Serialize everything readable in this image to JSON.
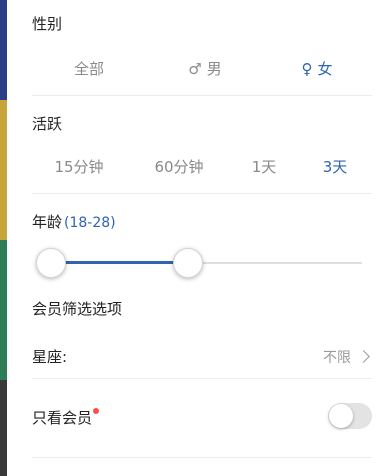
{
  "gender": {
    "label": "性别",
    "options": [
      {
        "label": "全部",
        "symbol": "",
        "active": false
      },
      {
        "label": "男",
        "symbol": "♂",
        "active": false
      },
      {
        "label": "女",
        "symbol": "♀",
        "active": true
      }
    ]
  },
  "active": {
    "label": "活跃",
    "options": [
      {
        "label": "15分钟",
        "active": false
      },
      {
        "label": "60分钟",
        "active": false
      },
      {
        "label": "1天",
        "active": false
      },
      {
        "label": "3天",
        "active": true
      }
    ]
  },
  "age": {
    "label": "年龄",
    "range": "(18-28)",
    "min_value": 18,
    "max_value": 28
  },
  "member_filter": {
    "title": "会员筛选选项",
    "zodiac_label": "星座:",
    "zodiac_value": "不限",
    "member_only_label": "只看会员",
    "member_only_on": false
  },
  "colors": {
    "accent": "#2f63b3",
    "inactive_text": "#8a8a8a",
    "badge": "#ff4d4f"
  }
}
